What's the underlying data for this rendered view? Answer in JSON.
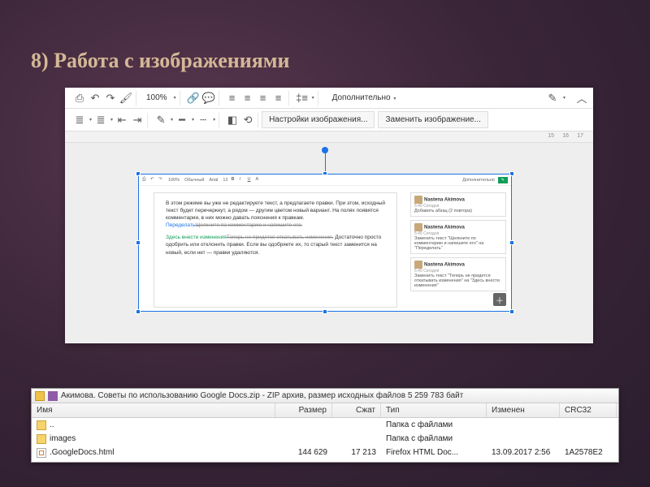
{
  "slide": {
    "title": "8) Работа с изображениями"
  },
  "toolbar1": {
    "zoom": "100%",
    "more": "Дополнительно",
    "ruler_marks": [
      "15",
      "16",
      "17"
    ]
  },
  "toolbar2": {
    "img_settings": "Настройки изображения...",
    "img_replace": "Заменить изображение..."
  },
  "inner": {
    "zoom": "100%",
    "style": "Обычный",
    "font": "Arial",
    "size": "12",
    "more": "Дополнительно",
    "doc_p1": "В этом режиме вы уже не редактируете текст, а предлагаете правки. При этом, исходный текст будет перечеркнут, а рядом — другим цветом новый вариант. На полях появятся комментарии, в них можно давать пояснения к правкам.",
    "doc_p1b_lnk": "Переделать",
    "doc_p1b_strike": "Щелкните по комментарию и напишите его.",
    "doc_p2_grn": "Здесь внести изменения",
    "doc_p2_strike": "Теперь не придется откатывать изменения.",
    "doc_p2_rest": " Достаточно просто одобрить или отклонить правки. Если вы одобряете их, то старый текст заменится на новый, если нет — правки удаляются.",
    "comments": [
      {
        "name": "Nastena Akimova",
        "time": "5:40 Сегодня",
        "text": "Добавить абзац (2 повтора)"
      },
      {
        "name": "Nastena Akimova",
        "time": "5:45 Сегодня",
        "text": "Заменить текст \"Щелкните по комментарию и напишите его\" на \"Переделать\""
      },
      {
        "name": "Nastena Akimova",
        "time": "5:45 Сегодня",
        "text": "Заменить текст \"Теперь не придется откатывать изменения\" на \"Здесь внести изменения\""
      }
    ]
  },
  "archive": {
    "title": "Акимова. Советы по использованию Google Docs.zip - ZIP архив, размер исходных файлов 5 259 783 байт",
    "cols": {
      "name": "Имя",
      "size": "Размер",
      "pack": "Сжат",
      "type": "Тип",
      "mod": "Изменен",
      "crc": "CRC32"
    },
    "rows": [
      {
        "name": "..",
        "size": "",
        "pack": "",
        "type": "Папка с файлами",
        "mod": "",
        "crc": "",
        "icon": "up"
      },
      {
        "name": "images",
        "size": "",
        "pack": "",
        "type": "Папка с файлами",
        "mod": "",
        "crc": "",
        "icon": "folder"
      },
      {
        "name": ".GoogleDocs.html",
        "size": "144 629",
        "pack": "17 213",
        "type": "Firefox HTML Doc...",
        "mod": "13.09.2017 2:56",
        "crc": "1A2578E2",
        "icon": "html"
      }
    ]
  }
}
